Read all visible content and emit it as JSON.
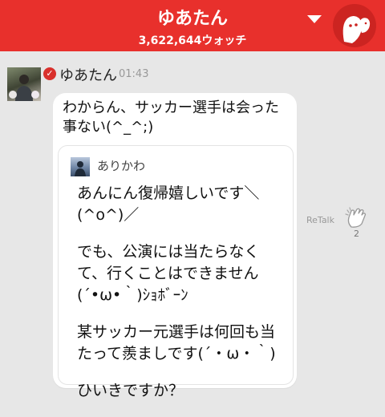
{
  "header": {
    "title": "ゆあたん",
    "watch_count": "3,622,644ウォッチ"
  },
  "post": {
    "author": "ゆあたん",
    "time": "01:43",
    "message": "わからん、サッカー選手は会った事ない(^_^;)",
    "quote": {
      "author": "ありかわ",
      "paragraphs": [
        "あんにん復帰嬉しいです＼(^o^)／",
        "でも、公演には当たらなくて、行くことはできません(´•ω•｀)ｼｮﾎﾞｰﾝ",
        "某サッカー元選手は何回も当たって羨ましです(´・ω・｀)",
        "ひいきですか？"
      ]
    }
  },
  "actions": {
    "retalk_label": "ReTalk",
    "clap_count": "2"
  }
}
